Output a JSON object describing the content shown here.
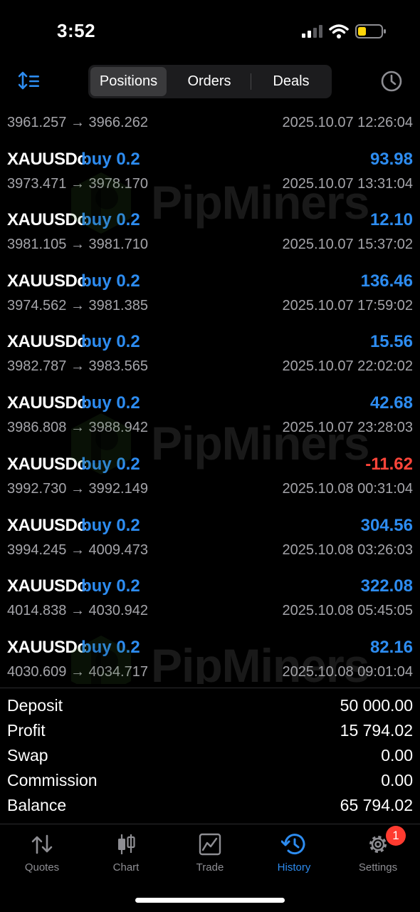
{
  "status_bar": {
    "time": "3:52"
  },
  "header": {
    "tabs": [
      {
        "label": "Positions",
        "selected": true
      },
      {
        "label": "Orders",
        "selected": false
      },
      {
        "label": "Deals",
        "selected": false
      }
    ]
  },
  "partial_row": {
    "prices": "3961.257 → 3966.262",
    "time": "2025.10.07 12:26:04"
  },
  "deals": [
    {
      "symbol": "XAUUSDc",
      "side": "buy 0.2",
      "profit": "93.98",
      "prices": "3973.471 → 3978.170",
      "time": "2025.10.07 13:31:04",
      "negative": false
    },
    {
      "symbol": "XAUUSDc",
      "side": "buy 0.2",
      "profit": "12.10",
      "prices": "3981.105 → 3981.710",
      "time": "2025.10.07 15:37:02",
      "negative": false
    },
    {
      "symbol": "XAUUSDc",
      "side": "buy 0.2",
      "profit": "136.46",
      "prices": "3974.562 → 3981.385",
      "time": "2025.10.07 17:59:02",
      "negative": false
    },
    {
      "symbol": "XAUUSDc",
      "side": "buy 0.2",
      "profit": "15.56",
      "prices": "3982.787 → 3983.565",
      "time": "2025.10.07 22:02:02",
      "negative": false
    },
    {
      "symbol": "XAUUSDc",
      "side": "buy 0.2",
      "profit": "42.68",
      "prices": "3986.808 → 3988.942",
      "time": "2025.10.07 23:28:03",
      "negative": false
    },
    {
      "symbol": "XAUUSDc",
      "side": "buy 0.2",
      "profit": "-11.62",
      "prices": "3992.730 → 3992.149",
      "time": "2025.10.08 00:31:04",
      "negative": true
    },
    {
      "symbol": "XAUUSDc",
      "side": "buy 0.2",
      "profit": "304.56",
      "prices": "3994.245 → 4009.473",
      "time": "2025.10.08 03:26:03",
      "negative": false
    },
    {
      "symbol": "XAUUSDc",
      "side": "buy 0.2",
      "profit": "322.08",
      "prices": "4014.838 → 4030.942",
      "time": "2025.10.08 05:45:05",
      "negative": false
    },
    {
      "symbol": "XAUUSDc",
      "side": "buy 0.2",
      "profit": "82.16",
      "prices": "4030.609 → 4034.717",
      "time": "2025.10.08 09:01:04",
      "negative": false
    }
  ],
  "watermark": {
    "text": "PipMiners"
  },
  "summary": [
    {
      "label": "Deposit",
      "value": "50 000.00"
    },
    {
      "label": "Profit",
      "value": "15 794.02"
    },
    {
      "label": "Swap",
      "value": "0.00"
    },
    {
      "label": "Commission",
      "value": "0.00"
    },
    {
      "label": "Balance",
      "value": "65 794.02"
    }
  ],
  "tabbar": {
    "items": [
      {
        "label": "Quotes",
        "icon": "quotes-icon"
      },
      {
        "label": "Chart",
        "icon": "chart-icon"
      },
      {
        "label": "Trade",
        "icon": "trade-icon"
      },
      {
        "label": "History",
        "icon": "history-icon",
        "active": true
      },
      {
        "label": "Settings",
        "icon": "gear-icon",
        "badge": "1"
      }
    ]
  },
  "colors": {
    "accent": "#2d8cf0",
    "negative": "#ff453a",
    "secondary_text": "#a5a5aa",
    "background": "#000000"
  }
}
